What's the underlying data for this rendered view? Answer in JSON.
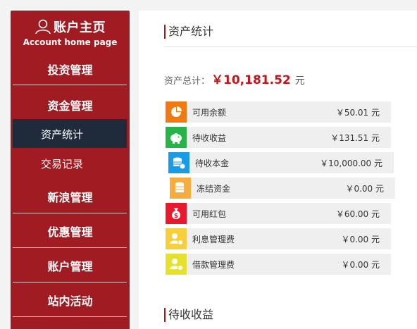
{
  "sidebar": {
    "title": "账户主页",
    "subtitle": "Account home page",
    "items": [
      {
        "label": "投资管理"
      },
      {
        "label": "资金管理"
      },
      {
        "label": "资产统计"
      },
      {
        "label": "交易记录"
      },
      {
        "label": "新浪管理"
      },
      {
        "label": "优惠管理"
      },
      {
        "label": "账户管理"
      },
      {
        "label": "站内活动"
      }
    ]
  },
  "main": {
    "section1_title": "资产统计",
    "total_label": "资产总计：",
    "total_amount": "￥10,181.52",
    "total_unit": "元",
    "rows": [
      {
        "label": "可用余额",
        "value": "￥50.01 元",
        "icon": "pie-chart-icon",
        "color": "#f07a11"
      },
      {
        "label": "待收收益",
        "value": "￥131.51 元",
        "icon": "piggy-bank-icon",
        "color": "#27b24a"
      },
      {
        "label": "待收本金",
        "value": "￥10,000.00 元",
        "icon": "coin-stack-icon",
        "color": "#1a9be5"
      },
      {
        "label": "冻结资金",
        "value": "￥0.00 元",
        "icon": "frozen-database-icon",
        "color": "#f6ad3d"
      },
      {
        "label": "可用红包",
        "value": "￥60.00 元",
        "icon": "money-bag-icon",
        "color": "#e8192c"
      },
      {
        "label": "利息管理费",
        "value": "￥0.00 元",
        "icon": "user-interest-icon",
        "color": "#f6cf3a"
      },
      {
        "label": "借款管理费",
        "value": "￥0.00 元",
        "icon": "user-loan-icon",
        "color": "#e6e02f"
      }
    ],
    "section2_title": "待收收益"
  },
  "colors": {
    "sidebar_bg": "#a11b22",
    "active_bg": "#1f2b3a",
    "accent": "#c0151c"
  }
}
